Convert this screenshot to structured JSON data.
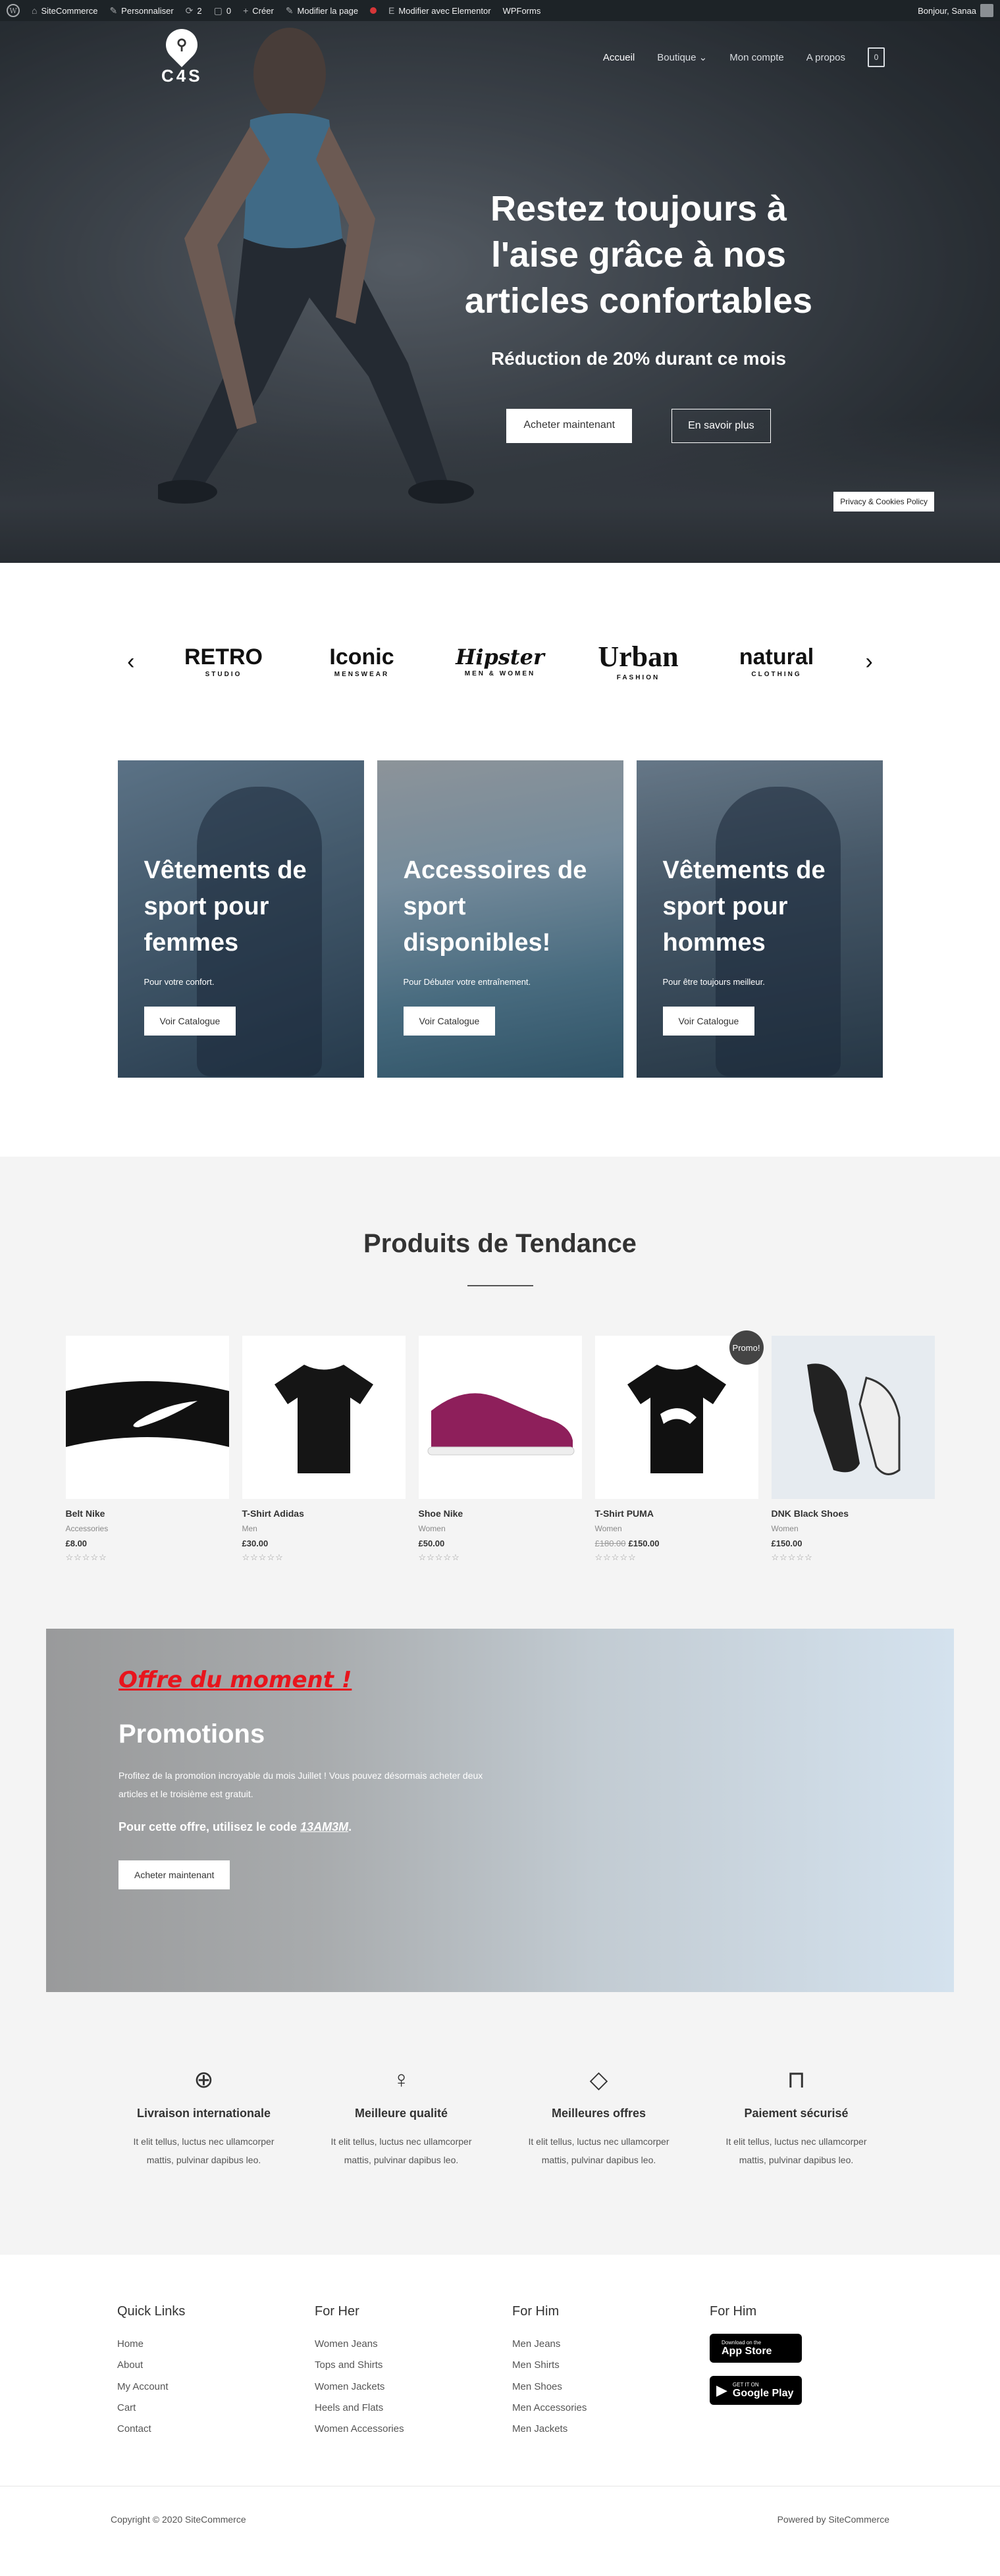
{
  "admin_bar": {
    "site": "SiteCommerce",
    "customize": "Personnaliser",
    "updates": "2",
    "comments": "0",
    "new": "Créer",
    "edit_page": "Modifier la page",
    "elementor": "Modifier avec Elementor",
    "wpforms": "WPForms",
    "greeting": "Bonjour, Sanaa"
  },
  "header": {
    "logo_text": "C4S",
    "nav": [
      "Accueil",
      "Boutique",
      "Mon compte",
      "A propos"
    ],
    "cart_count": "0"
  },
  "hero": {
    "title": "Restez toujours à l'aise grâce à nos articles confortables",
    "subtitle": "Réduction de 20% durant ce mois",
    "btn_primary": "Acheter maintenant",
    "btn_secondary": "En savoir plus",
    "privacy": "Privacy & Cookies Policy"
  },
  "brands": [
    {
      "main": "RETRO",
      "sub": "STUDIO"
    },
    {
      "main": "Iconic",
      "sub": "MENSWEAR"
    },
    {
      "main": "Hipster",
      "sub": "MEN & WOMEN"
    },
    {
      "main": "Urban",
      "sub": "FASHION"
    },
    {
      "main": "natural",
      "sub": "CLOTHING"
    }
  ],
  "categories": [
    {
      "title": "Vêtements de sport pour femmes",
      "text": "Pour votre confort.",
      "button": "Voir Catalogue"
    },
    {
      "title": "Accessoires de sport disponibles!",
      "text": "Pour Débuter votre entraînement.",
      "button": "Voir Catalogue"
    },
    {
      "title": "Vêtements de sport pour hommes",
      "text": "Pour être toujours meilleur.",
      "button": "Voir Catalogue"
    }
  ],
  "trending": {
    "title": "Produits de Tendance",
    "products": [
      {
        "name": "Belt Nike",
        "category": "Accessories",
        "price": "£8.00",
        "old_price": "",
        "promo": ""
      },
      {
        "name": "T-Shirt Adidas",
        "category": "Men",
        "price": "£30.00",
        "old_price": "",
        "promo": ""
      },
      {
        "name": "Shoe Nike",
        "category": "Women",
        "price": "£50.00",
        "old_price": "",
        "promo": ""
      },
      {
        "name": "T-Shirt PUMA",
        "category": "Women",
        "price": "£150.00",
        "old_price": "£180.00",
        "promo": "Promo!"
      },
      {
        "name": "DNK Black Shoes",
        "category": "Women",
        "price": "£150.00",
        "old_price": "",
        "promo": ""
      }
    ],
    "stars": "☆☆☆☆☆"
  },
  "promo": {
    "offer": "Offre du moment !",
    "title": "Promotions",
    "text": "Profitez de la promotion incroyable du mois Juillet ! Vous pouvez désormais acheter deux articles et le troisième est gratuit.",
    "code_prefix": "Pour cette offre, utilisez le code ",
    "code": "13AM3M",
    "code_suffix": ".",
    "button": "Acheter maintenant"
  },
  "features": [
    {
      "icon": "globe-icon",
      "title": "Livraison internationale",
      "text": "It elit tellus, luctus nec ullamcorper mattis, pulvinar dapibus leo."
    },
    {
      "icon": "dress-icon",
      "title": "Meilleure qualité",
      "text": "It elit tellus, luctus nec ullamcorper mattis, pulvinar dapibus leo."
    },
    {
      "icon": "price-tag-icon",
      "title": "Meilleures offres",
      "text": "It elit tellus, luctus nec ullamcorper mattis, pulvinar dapibus leo."
    },
    {
      "icon": "lock-icon",
      "title": "Paiement sécurisé",
      "text": "It elit tellus, luctus nec ullamcorper mattis, pulvinar dapibus leo."
    }
  ],
  "footer": {
    "columns": [
      {
        "title": "Quick Links",
        "links": [
          "Home",
          "About",
          "My Account",
          "Cart",
          "Contact"
        ]
      },
      {
        "title": "For Her",
        "links": [
          "Women Jeans",
          "Tops and Shirts",
          "Women Jackets",
          "Heels and Flats",
          "Women Accessories"
        ]
      },
      {
        "title": "For Him",
        "links": [
          "Men Jeans",
          "Men Shirts",
          "Men Shoes",
          "Men Accessories",
          "Men Jackets"
        ]
      }
    ],
    "apps_title": "For Him",
    "app_store": {
      "small": "Download on the",
      "big": "App Store"
    },
    "google_play": {
      "small": "GET IT ON",
      "big": "Google Play"
    },
    "copyright": "Copyright © 2020 SiteCommerce",
    "powered": "Powered by SiteCommerce"
  }
}
